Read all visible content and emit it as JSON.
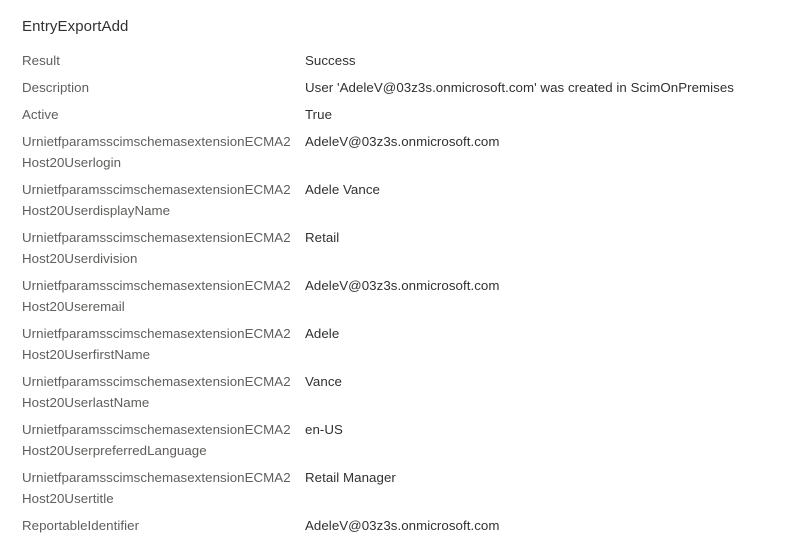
{
  "panel": {
    "title": "EntryExportAdd"
  },
  "details": {
    "rows": [
      {
        "label": "Result",
        "value": "Success"
      },
      {
        "label": "Description",
        "value": "User 'AdeleV@03z3s.onmicrosoft.com' was created in ScimOnPremises"
      },
      {
        "label": "Active",
        "value": "True"
      },
      {
        "label": "UrnietfparamsscimschemasextensionECMA2Host20Userlogin",
        "value": "AdeleV@03z3s.onmicrosoft.com"
      },
      {
        "label": "UrnietfparamsscimschemasextensionECMA2Host20UserdisplayName",
        "value": "Adele Vance"
      },
      {
        "label": "UrnietfparamsscimschemasextensionECMA2Host20Userdivision",
        "value": "Retail"
      },
      {
        "label": "UrnietfparamsscimschemasextensionECMA2Host20Useremail",
        "value": "AdeleV@03z3s.onmicrosoft.com"
      },
      {
        "label": "UrnietfparamsscimschemasextensionECMA2Host20UserfirstName",
        "value": "Adele"
      },
      {
        "label": "UrnietfparamsscimschemasextensionECMA2Host20UserlastName",
        "value": "Vance"
      },
      {
        "label": "UrnietfparamsscimschemasextensionECMA2Host20UserpreferredLanguage",
        "value": "en-US"
      },
      {
        "label": "UrnietfparamsscimschemasextensionECMA2Host20Usertitle",
        "value": "Retail Manager"
      },
      {
        "label": "ReportableIdentifier",
        "value": "AdeleV@03z3s.onmicrosoft.com"
      }
    ]
  },
  "colors": {
    "background": "#ffffff",
    "label_text": "#605e5c",
    "value_text": "#323130",
    "title_text": "#323130"
  }
}
